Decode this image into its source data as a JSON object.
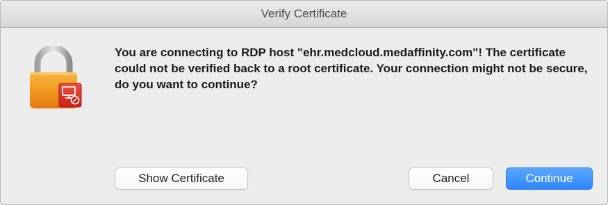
{
  "dialog": {
    "title": "Verify Certificate",
    "message": "You are connecting to RDP host \"ehr.medcloud.medaffinity.com\"! The certificate could not be verified back to a root certificate. Your connection might not be secure, do you want to continue?",
    "icon": "lock-with-remote-desktop-badge-icon"
  },
  "buttons": {
    "show_certificate": "Show Certificate",
    "cancel": "Cancel",
    "continue": "Continue"
  },
  "colors": {
    "primary_button": "#3b8ff9",
    "lock_body": "#f0a030",
    "badge": "#e2332a"
  }
}
